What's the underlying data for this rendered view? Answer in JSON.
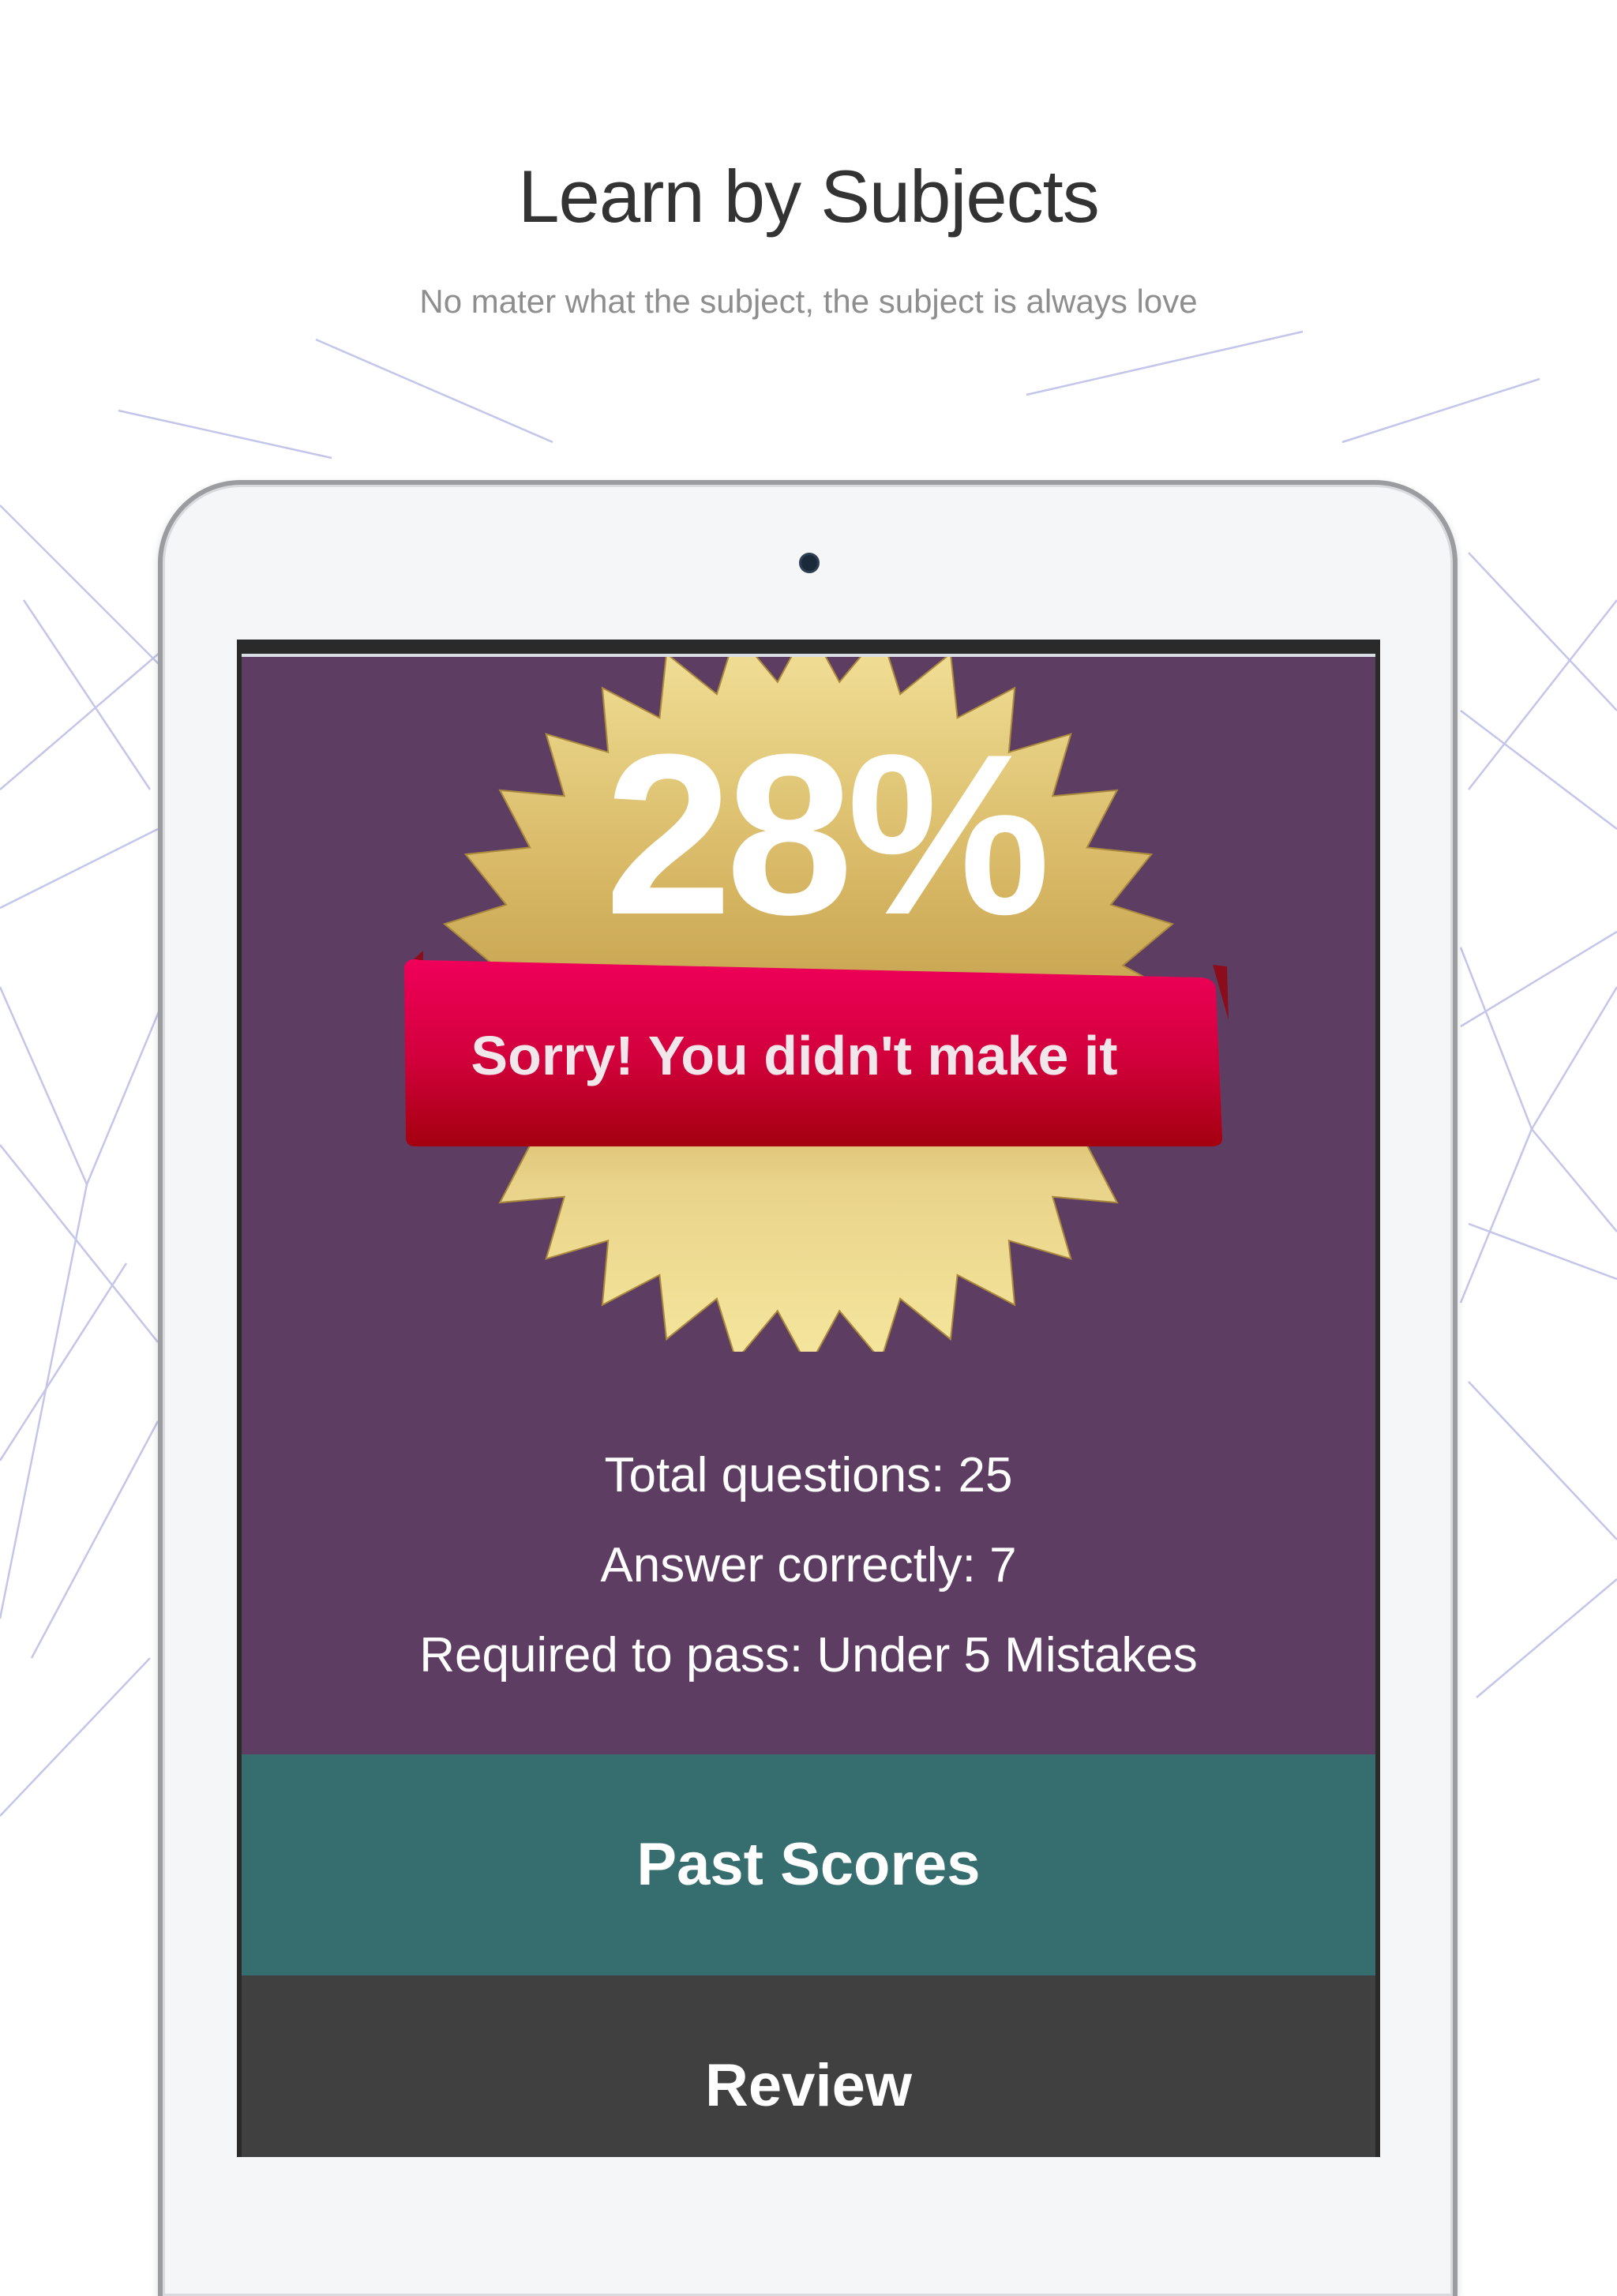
{
  "header": {
    "title": "Learn by Subjects",
    "subtitle": "No mater what the subject, the subject is always love"
  },
  "result": {
    "score": "28%",
    "status": "Sorry! You didn't make it",
    "stats": [
      "Total questions: 25",
      "Answer correctly: 7",
      "Required to pass: Under 5 Mistakes"
    ]
  },
  "actions": {
    "past_scores_label": "Past Scores",
    "review_label": "Review"
  },
  "colors": {
    "result_bg": "#5e3d62",
    "past_scores_bg": "#366d6e",
    "review_bg": "#404040",
    "ribbon": "#d2003a",
    "badge_gold": "#c8a24d"
  },
  "icons": {
    "badge": "gold-seal-icon",
    "ribbon": "ribbon-banner-icon"
  }
}
